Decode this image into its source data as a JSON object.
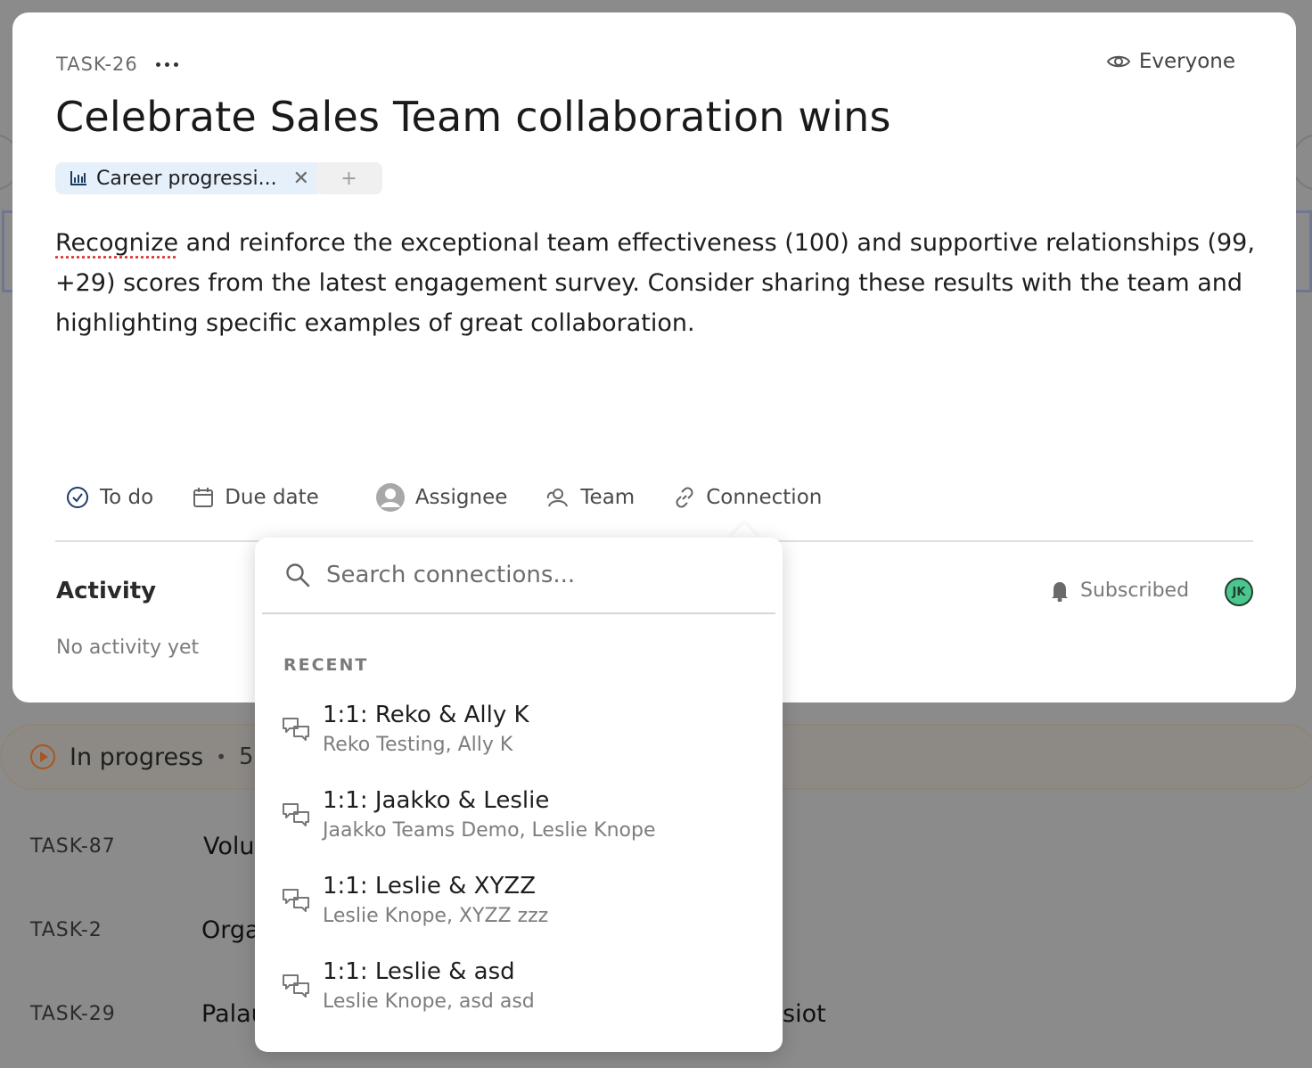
{
  "task": {
    "key": "TASK-26",
    "title": "Celebrate Sales Team collaboration wins",
    "visibility": "Everyone",
    "tag": "Career progressi...",
    "add_tag": "+",
    "description_first_word": "Recognize",
    "description_rest": " and reinforce the exceptional team effectiveness (100) and supportive relationships (99, +29) scores from the latest engagement survey. Consider sharing these results with the team and highlighting specific examples of great collaboration."
  },
  "properties": {
    "status": "To do",
    "due_date": "Due date",
    "assignee": "Assignee",
    "team": "Team",
    "connection": "Connection"
  },
  "activity": {
    "title": "Activity",
    "empty": "No activity yet",
    "subscribed": "Subscribed",
    "avatar_initials": "JK"
  },
  "connections_popover": {
    "search_placeholder": "Search connections...",
    "section_label": "RECENT",
    "items": [
      {
        "title": "1:1: Reko & Ally K",
        "members": "Reko Testing, Ally K"
      },
      {
        "title": "1:1: Jaakko & Leslie",
        "members": "Jaakko Teams Demo, Leslie Knope"
      },
      {
        "title": "1:1: Leslie & XYZZ",
        "members": "Leslie Knope, XYZZ zzz"
      },
      {
        "title": "1:1: Leslie & asd",
        "members": "Leslie Knope, asd asd"
      }
    ]
  },
  "background": {
    "group_label": "In progress",
    "group_separator": "•",
    "group_count": "5",
    "rows": [
      {
        "id": "TASK-87",
        "title": "Volu"
      },
      {
        "id": "TASK-2",
        "title": "Orga"
      },
      {
        "id": "TASK-29",
        "title": "Palau"
      }
    ],
    "row_tail": "siot"
  },
  "colors": {
    "tag_bg": "#e6f0fb",
    "avatar_bg": "#4cc58f",
    "in_progress_accent": "#a8561f",
    "overlay": "#8b8b8b"
  }
}
